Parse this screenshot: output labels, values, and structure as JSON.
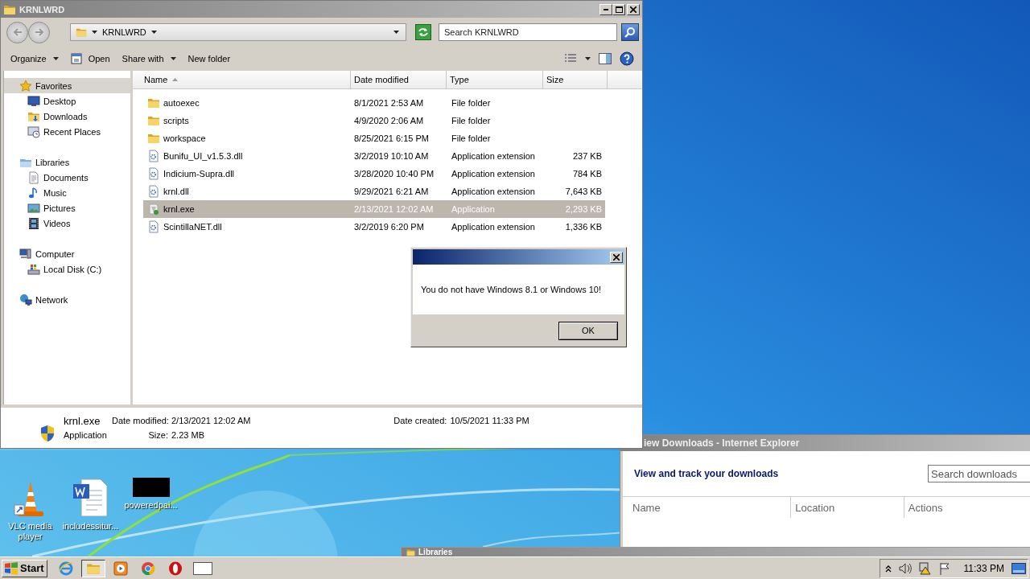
{
  "explorer": {
    "title": "KRNLWRD",
    "address": "KRNLWRD",
    "search": {
      "placeholder": "Search KRNLWRD"
    },
    "toolbar": [
      {
        "label": "Organize",
        "kind": "menu"
      },
      {
        "label": "Open",
        "kind": "open"
      },
      {
        "label": "Share with",
        "kind": "menu"
      },
      {
        "label": "New folder",
        "kind": "plain"
      }
    ],
    "sidebar": [
      {
        "label": "Favorites",
        "kind": "star",
        "selected": true,
        "children": [
          {
            "label": "Desktop",
            "kind": "desktop",
            "selected": false
          },
          {
            "label": "Downloads",
            "kind": "downloads",
            "selected": false
          },
          {
            "label": "Recent Places",
            "kind": "recent",
            "selected": false
          }
        ]
      },
      {
        "label": "Libraries",
        "kind": "libraries",
        "selected": false,
        "children": [
          {
            "label": "Documents",
            "kind": "documents",
            "selected": false
          },
          {
            "label": "Music",
            "kind": "music",
            "selected": false
          },
          {
            "label": "Pictures",
            "kind": "pictures",
            "selected": false
          },
          {
            "label": "Videos",
            "kind": "videos",
            "selected": false
          }
        ]
      },
      {
        "label": "Computer",
        "kind": "computer",
        "selected": false,
        "children": [
          {
            "label": "Local Disk (C:)",
            "kind": "disk",
            "selected": false
          }
        ]
      },
      {
        "label": "Network",
        "kind": "network",
        "selected": false
      }
    ],
    "columns": [
      {
        "label": "Name",
        "sorted": true
      },
      {
        "label": "Date modified",
        "sorted": false
      },
      {
        "label": "Type",
        "sorted": false
      },
      {
        "label": "Size",
        "sorted": false
      }
    ],
    "rows": [
      {
        "name": "autoexec",
        "date": "8/1/2021 2:53 AM",
        "type": "File folder",
        "kind": "folder",
        "selected": false
      },
      {
        "name": "scripts",
        "date": "4/9/2020 2:06 AM",
        "type": "File folder",
        "kind": "folder",
        "selected": false
      },
      {
        "name": "workspace",
        "date": "8/25/2021 6:15 PM",
        "type": "File folder",
        "kind": "folder",
        "selected": false
      },
      {
        "name": "Bunifu_UI_v1.5.3.dll",
        "date": "3/2/2019 10:10 AM",
        "type": "Application extension",
        "size": "237 KB",
        "kind": "dll",
        "selected": false
      },
      {
        "name": "Indicium-Supra.dll",
        "date": "3/28/2020 10:40 PM",
        "type": "Application extension",
        "size": "784 KB",
        "kind": "dll",
        "selected": false
      },
      {
        "name": "krnl.dll",
        "date": "9/29/2021 6:21 AM",
        "type": "Application extension",
        "size": "7,643 KB",
        "kind": "dll",
        "selected": false
      },
      {
        "name": "krnl.exe",
        "date": "2/13/2021 12:02 AM",
        "type": "Application",
        "size": "2,293 KB",
        "kind": "exe",
        "selected": true
      },
      {
        "name": "ScintillaNET.dll",
        "date": "3/2/2019 6:20 PM",
        "type": "Application extension",
        "size": "1,336 KB",
        "kind": "dll",
        "selected": false
      }
    ],
    "details": {
      "name": "krnl.exe",
      "type": "Application",
      "fields": [
        {
          "label": "Date modified:",
          "value": "2/13/2021 12:02 AM"
        },
        {
          "label": "Date created:",
          "value": "10/5/2021 11:33 PM"
        },
        {
          "label": "Size:",
          "value": "2.23 MB"
        }
      ]
    }
  },
  "dialog": {
    "message": "You do not have Windows 8.1 or Windows 10!",
    "button": "OK"
  },
  "downloads_window": {
    "title": "iew Downloads - Internet Explorer",
    "heading": "View and track your downloads",
    "search": {
      "placeholder": "Search downloads"
    },
    "columns": [
      "Name",
      "Location",
      "Actions"
    ]
  },
  "background_window": {
    "title": "Libraries"
  },
  "desktop_icons": [
    {
      "label": "VLC media player",
      "kind": "vlc"
    },
    {
      "label": "includessitur...",
      "kind": "word"
    },
    {
      "label": "poweredpai...",
      "kind": "blank"
    }
  ],
  "taskbar": {
    "start": "Start",
    "apps": [
      {
        "kind": "ie",
        "active": false
      },
      {
        "kind": "explorer",
        "active": true
      },
      {
        "kind": "media",
        "active": false
      },
      {
        "kind": "chrome",
        "active": false
      },
      {
        "kind": "opera",
        "active": false
      },
      {
        "kind": "window",
        "active": false
      }
    ],
    "time": "11:33 PM"
  }
}
